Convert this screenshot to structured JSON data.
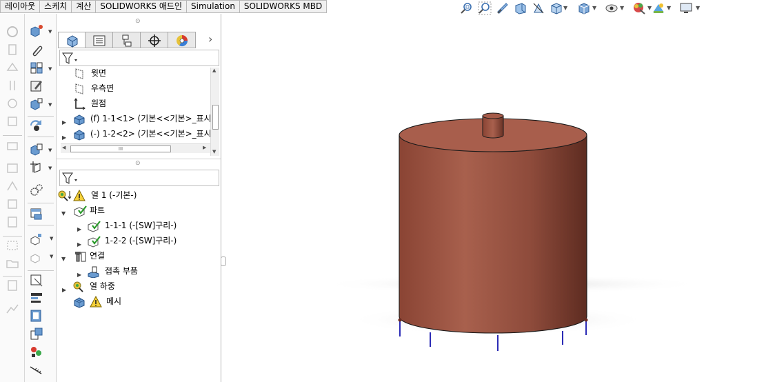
{
  "command_tabs": [
    "레이아웃",
    "스케치",
    "계산",
    "SOLIDWORKS 애드인",
    "Simulation",
    "SOLIDWORKS MBD"
  ],
  "view_toolbar": {
    "icons": [
      "zoom-to-fit-icon",
      "zoom-area-icon",
      "previous-view-icon",
      "section-view-icon",
      "dynamic-annotation-icon",
      "view-orientation-icon",
      "display-style-icon",
      "hide-show-icon",
      "edit-appearance-icon",
      "apply-scene-icon",
      "view-settings-icon"
    ]
  },
  "feature_tree": {
    "items": [
      {
        "label": "윗면",
        "icon": "plane-icon"
      },
      {
        "label": "우측면",
        "icon": "plane-icon"
      },
      {
        "label": "원점",
        "icon": "origin-icon"
      },
      {
        "label": "(f) 1-1<1> (기본<<기본>_표시 ·",
        "icon": "part-icon"
      },
      {
        "label": "(-) 1-2<2> (기본<<기본>_표시",
        "icon": "part-icon"
      }
    ]
  },
  "scroll": {
    "thumb_label": "III"
  },
  "study_tree": {
    "items": [
      {
        "label": "열 1 (-기본-)",
        "icon": "thermal-study-icon"
      },
      {
        "label": "파트",
        "icon": "parts-folder-icon"
      },
      {
        "label": "1-1-1 (-[SW]구리-)",
        "icon": "material-part-icon"
      },
      {
        "label": "1-2-2 (-[SW]구리-)",
        "icon": "material-part-icon"
      },
      {
        "label": "연결",
        "icon": "connections-icon"
      },
      {
        "label": "접촉 부품",
        "icon": "contact-sets-icon"
      },
      {
        "label": "열 하중",
        "icon": "thermal-loads-icon"
      },
      {
        "label": "메시",
        "icon": "mesh-icon"
      }
    ]
  },
  "colors": {
    "cylinder": "#9a4f3f",
    "cylinder_top": "#a45a49",
    "edge": "#1a1a1a",
    "fixture": "#2b2bb5"
  }
}
